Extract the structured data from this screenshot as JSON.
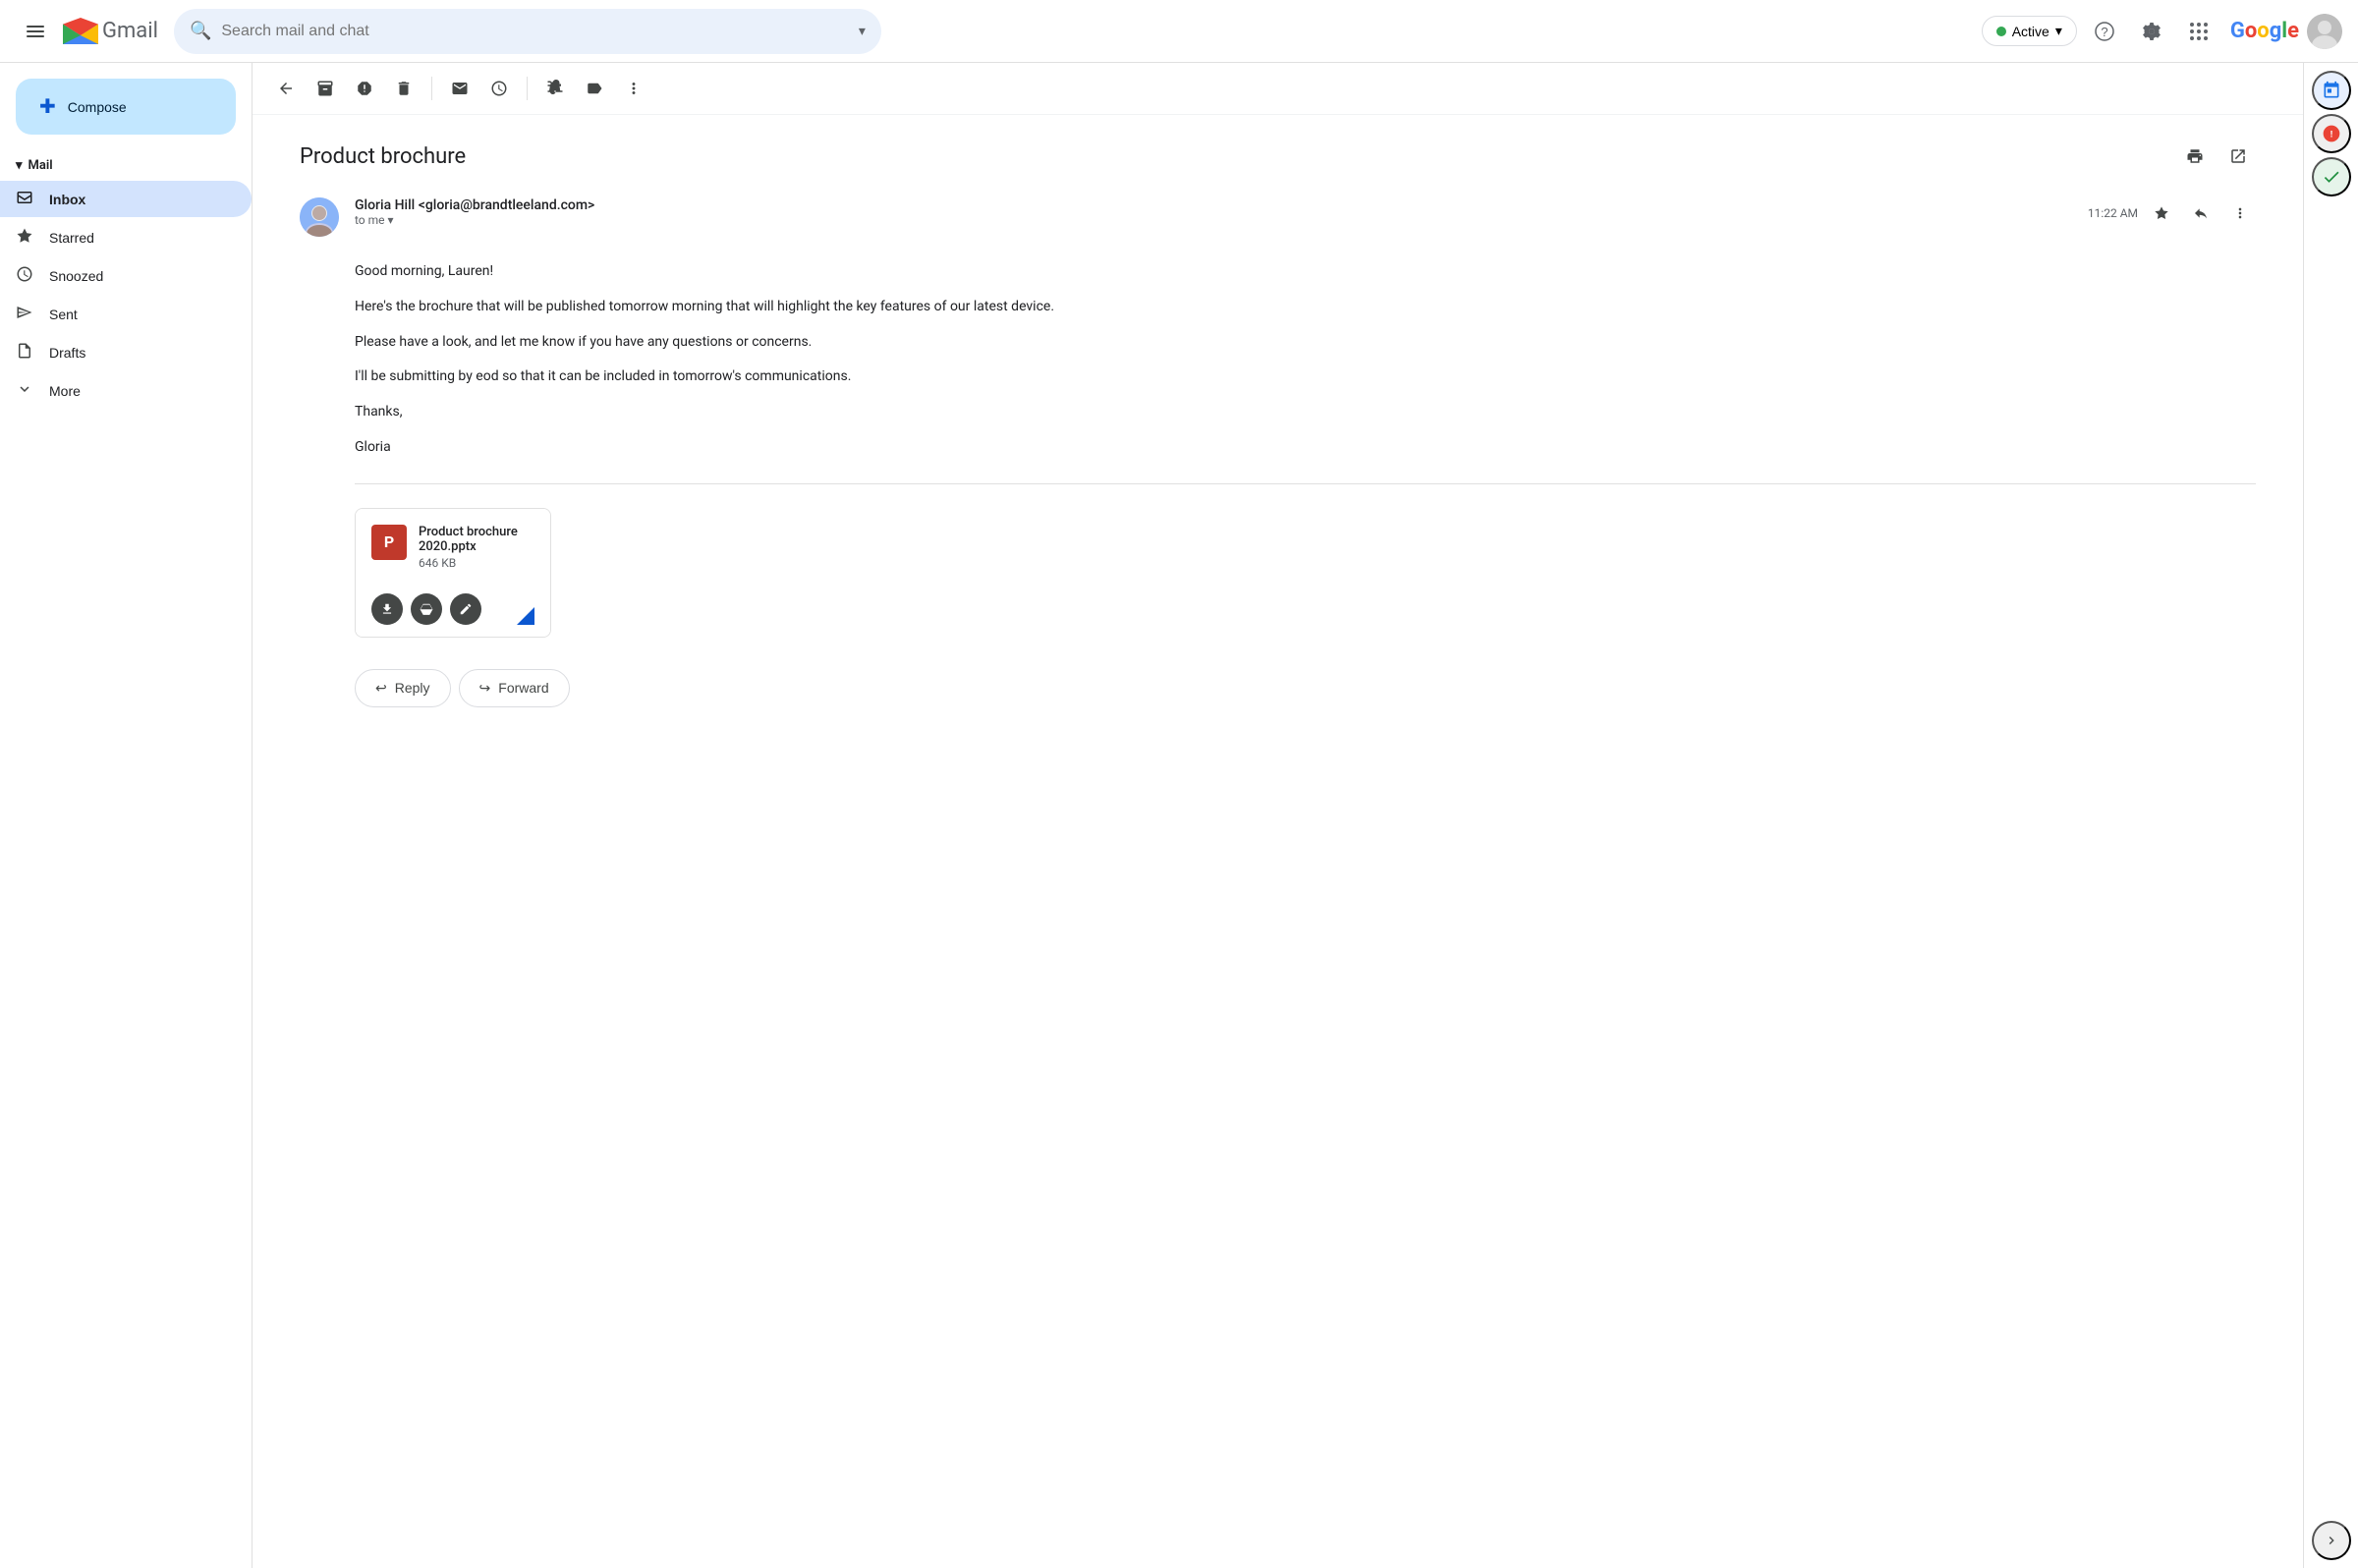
{
  "app": {
    "title": "Gmail",
    "logo_text": "Gmail"
  },
  "topbar": {
    "search_placeholder": "Search mail and chat",
    "active_label": "Active",
    "help_icon": "?",
    "settings_icon": "⚙"
  },
  "google_logo": {
    "letters": [
      "G",
      "o",
      "o",
      "g",
      "l",
      "e"
    ]
  },
  "sidebar": {
    "compose_label": "Compose",
    "mail_section": "Mail",
    "nav_items": [
      {
        "label": "Inbox",
        "icon": "☐",
        "active": true
      },
      {
        "label": "Starred",
        "icon": "☆",
        "active": false
      },
      {
        "label": "Snoozed",
        "icon": "⏰",
        "active": false
      },
      {
        "label": "Sent",
        "icon": "▷",
        "active": false
      },
      {
        "label": "Drafts",
        "icon": "📄",
        "active": false
      }
    ],
    "more_label": "More"
  },
  "toolbar": {
    "back_title": "Back",
    "archive_title": "Archive",
    "report_title": "Report spam",
    "delete_title": "Delete",
    "mark_title": "Mark as unread",
    "snooze_title": "Snooze",
    "move_title": "Move to",
    "label_title": "Labels",
    "more_title": "More"
  },
  "email": {
    "subject": "Product brochure",
    "sender_name": "Gloria Hill",
    "sender_email": "gloria@brandtleeland.com",
    "sender_display": "Gloria Hill <gloria@brandtleeland.com>",
    "to_label": "to me",
    "time": "11:22 AM",
    "body_greeting": "Good morning, Lauren!",
    "body_line1": "Here's the brochure that will be published tomorrow morning that will highlight the key features of our latest device.",
    "body_line2": "Please have a look, and let me know if you have any questions or concerns.",
    "body_line3": "I'll be submitting by eod so that it can be included in tomorrow's communications.",
    "body_sign": "Thanks,",
    "body_name": "Gloria",
    "attachment": {
      "name": "Product brochure 2020.pptx",
      "size": "646 KB",
      "icon_label": "P"
    }
  },
  "actions": {
    "reply_label": "Reply",
    "forward_label": "Forward",
    "reply_icon": "↩",
    "forward_icon": "↪"
  },
  "right_sidebar": {
    "icons": [
      "📅",
      "📝",
      "✓"
    ]
  }
}
